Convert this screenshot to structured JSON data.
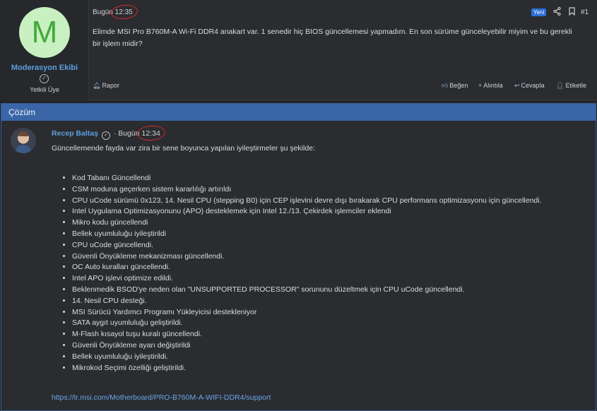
{
  "post1": {
    "avatar_letter": "M",
    "username": "Moderasyon Ekibi",
    "role": "Yetkili Üye",
    "date_prefix": "Bugün",
    "time": "12:35",
    "badge": "Yeni",
    "post_number": "#1",
    "body": "Elimde MSI Pro B760M-A Wi-Fi DDR4 anakart var. 1 senedir hiç BIOS güncellemesi yapmadım. En son sürüme günceleyebilir miyim ve bu gerekli bir işlem midir?",
    "actions": {
      "report": "Rapor",
      "like": "Beğen",
      "quote": "Alıntıla",
      "reply": "Cevapla",
      "tag": "Etiketle"
    }
  },
  "solution": {
    "header": "Çözüm",
    "author": "Recep Baltaş",
    "separator": "·",
    "date_prefix": "Bugün",
    "time": "12:34",
    "intro": "Güncellemende fayda var zira bir sene boyunca yapılan iyileştirmeler şu şekilde:",
    "items": [
      "Kod Tabanı Güncellendi",
      "CSM moduna geçerken sistem kararlılığı artırıldı",
      "CPU uCode sürümü 0x123, 14. Nesil CPU (stepping B0) için CEP işlevini devre dışı bırakarak CPU performans optimizasyonu için güncellendi.",
      "Intel Uygulama Optimizasyonunu (APO) desteklemek için Intel 12./13. Çekirdek işlemciler eklendi",
      "Mikro kodu güncellendi",
      "Bellek uyumluluğu iyileştirildi",
      "CPU uCode güncellendi.",
      "Güvenli Önyükleme mekanizması güncellendi.",
      "OC Auto kuralları güncellendi.",
      "Intel APO işlevi optimize edildi.",
      "Beklenmedik BSOD'ye neden olan \"UNSUPPORTED PROCESSOR\" sorununu düzeltmek için CPU uCode güncellendi.",
      "14. Nesil CPU desteği.",
      "MSI Sürücü Yardımcı Programı Yükleyicisi destekleniyor",
      "SATA aygıt uyumluluğu geliştirildi.",
      "M-Flash kısayol tuşu kuralı güncellendi.",
      "Güvenli Önyükleme ayarı değiştirildi",
      "Bellek uyumluluğu iyileştirildi.",
      "Mikrokod Seçimi özelliği geliştirildi."
    ],
    "link": "https://tr.msi.com/Motherboard/PRO-B760M-A-WIFI-DDR4/support"
  },
  "icons": {
    "verified": "check-circle-icon",
    "share": "share-icon",
    "bookmark": "bookmark-icon",
    "report": "bell-icon",
    "like": "thumbs-up-icon",
    "quote": "plus-icon",
    "reply": "reply-arrow-icon",
    "tag": "user-tag-icon"
  },
  "colors": {
    "accent": "#3a66a8",
    "username": "#5d9fe0",
    "badge": "#2c6fd6",
    "annotation": "#d62b2b"
  }
}
